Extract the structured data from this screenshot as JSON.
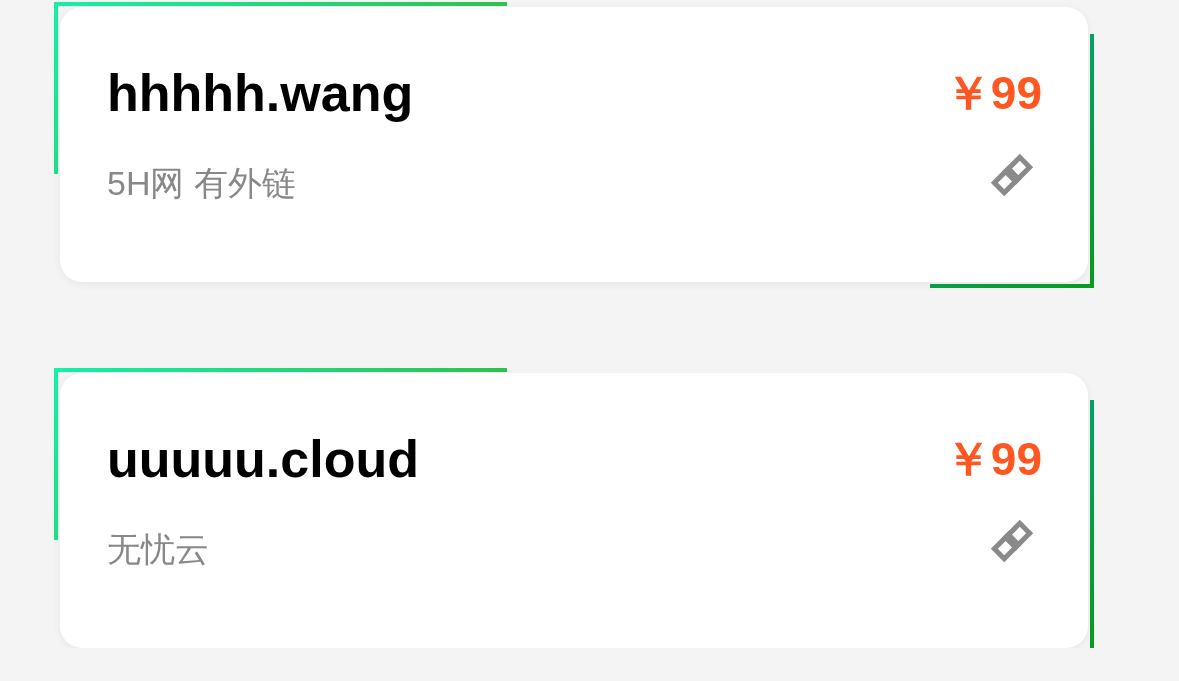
{
  "domains": [
    {
      "name": "hhhhh.wang",
      "price": "￥99",
      "description": "5H网 有外链"
    },
    {
      "name": "uuuuu.cloud",
      "price": "￥99",
      "description": "无忧云"
    }
  ]
}
